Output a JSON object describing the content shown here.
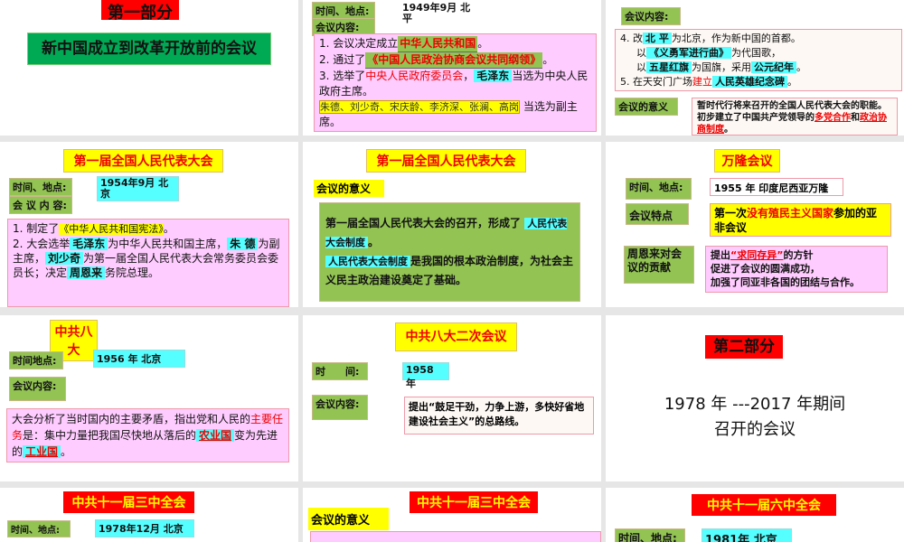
{
  "s1": {
    "part": "第一部分",
    "subtitle": "新中国成立到改革开放前的会议"
  },
  "s2": {
    "time_label": "时间、地点:",
    "time_value": "1949年9月 北平",
    "content_label": "会议内容:",
    "l1a": "1. 会议决定成立",
    "l1b": "中华人民共和国",
    "l1c": "。",
    "l2a": "2. 通过了",
    "l2b": "《中国人民政治协商会议共同纲领》",
    "l2c": "。",
    "l3a": "3. 选举了",
    "l3b": "中央人民政府委员会",
    "l3c": "，",
    "l3d": "毛泽东",
    "l3e": "当选为中央人民政府主席。",
    "l4a": "朱德、刘少奇、宋庆龄、李济深、张澜、高岗",
    "l4b": "当选为副主席。"
  },
  "s3": {
    "content_label": "会议内容:",
    "l1a": "4. 改",
    "l1b": "北 平",
    "l1c": "为北京，作为新中国的首都。",
    "l2a": "以",
    "l2b": "《义勇军进行曲》",
    "l2c": "为代国歌，",
    "l3a": "以",
    "l3b": "五星红旗",
    "l3c": "为国旗，采用",
    "l3d": "公元纪年",
    "l3e": "。",
    "l4a": "5. 在天安门广场",
    "l4b": "建立",
    "l4c": "人民英雄纪念碑",
    "l4d": "。",
    "sig_label": "会议的意义",
    "sig_a": "暂时代行将来召开的全国人民代表大会的职能。初步建立了中国共产党领导的",
    "sig_b": "多党合作",
    "sig_c": "和",
    "sig_d": "政治协商制度",
    "sig_e": "。"
  },
  "s4": {
    "title": "第一届全国人民代表大会",
    "time_label": "时间、地点:",
    "time_value": "1954年9月 北京",
    "content_label": "会 议 内 容:",
    "l1a": "1. 制定了",
    "l1b": "《中华人民共和国宪法》",
    "l1c": "。",
    "l2a": "2. 大会选举",
    "l2b": "毛泽东",
    "l2c": "为中华人民共和国主席，",
    "l2d": "朱 德",
    "l2e": "为副主席，",
    "l2f": "刘少奇",
    "l2g": "为第一届全国人民代表大会常务委员会委员长；决定",
    "l2h": "周恩来",
    "l2i": "务院总理。"
  },
  "s5": {
    "title": "第一届全国人民代表大会",
    "sig_label": "会议的意义",
    "a": "第一届全国人民代表大会的召开，形成了",
    "b": "人民代表大会制度",
    "c": "。",
    "d": "人民代表大会制度",
    "e": "是我国的根本政治制度，为社会主义民主政治建设奠定了基础。"
  },
  "s6": {
    "title": "万隆会议",
    "time_label": "时间、地点:",
    "time_value": "1955 年  印度尼西亚万隆",
    "feat_label": "会议特点",
    "feat_a": "第一次",
    "feat_b": "没有殖民主义国家",
    "feat_c": "参加的亚非会议",
    "zhou_label": "周恩来对会议的贡献",
    "z1a": "提出",
    "z1b": "“求同存异”",
    "z1c": "的方针",
    "z2": "促进了会议的圆满成功，",
    "z3": "加强了同亚非各国的团结与合作。"
  },
  "s7": {
    "title": "中共八大",
    "time_label": "时间地点:",
    "time_value": "1956 年  北京",
    "content_label": "会议内容:",
    "a": "大会分析了当时国内的主要矛盾，指出党和人民的",
    "b": "主要任务",
    "c": "是：集中力量把我国尽快地从落后的",
    "d": "农业国",
    "e": "变为先进的",
    "f": "工业国",
    "g": "。"
  },
  "s8": {
    "title": "中共八大二次会议",
    "time_label": "时　　间:",
    "time_value": "1958 年",
    "content_label": "会议内容:",
    "content": "提出“鼓足干劲，力争上游，多快好省地建设社会主义”的总路线。"
  },
  "s9": {
    "part": "第二部分",
    "line1": "1978 年 ---2017 年期间",
    "line2": "召开的会议"
  },
  "s10": {
    "title": "中共十一届三中全会",
    "time_label": "时间、地点:",
    "time_value": "1978年12月 北京"
  },
  "s11": {
    "title": "中共十一届三中全会",
    "sig_label": "会议的意义"
  },
  "s12": {
    "title": "中共十一届六中全会",
    "time_label": "时间、地点:",
    "time_value": "1981年 北京"
  }
}
